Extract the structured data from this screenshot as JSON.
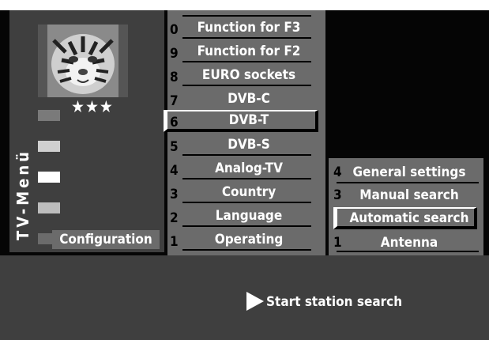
{
  "colors": {
    "panel": "#6b6b6b",
    "panel_dark": "#3f3f3f",
    "background": "#050505",
    "text": "#ffffff"
  },
  "left_panel": {
    "rating": "★★★",
    "vertical_title": "TV-Menü",
    "active_item": "Configuration",
    "thumbnail_icon": "tiger-thumbnail-icon"
  },
  "center_menu": {
    "items": [
      {
        "num": "0",
        "label": "Function for F3"
      },
      {
        "num": "9",
        "label": "Function for F2"
      },
      {
        "num": "8",
        "label": "EURO sockets"
      },
      {
        "num": "7",
        "label": "DVB-C"
      },
      {
        "num": "6",
        "label": "DVB-T",
        "selected": true
      },
      {
        "num": "5",
        "label": "DVB-S"
      },
      {
        "num": "4",
        "label": "Analog-TV"
      },
      {
        "num": "3",
        "label": "Country"
      },
      {
        "num": "2",
        "label": "Language"
      },
      {
        "num": "1",
        "label": "Operating"
      }
    ]
  },
  "right_menu": {
    "items": [
      {
        "num": "4",
        "label": "General settings"
      },
      {
        "num": "3",
        "label": "Manual search"
      },
      {
        "num": "",
        "label": "Automatic search",
        "selected": true
      },
      {
        "num": "1",
        "label": "Antenna"
      }
    ]
  },
  "bottom": {
    "action_label": "Start station search",
    "action_icon": "play-arrow-icon"
  }
}
